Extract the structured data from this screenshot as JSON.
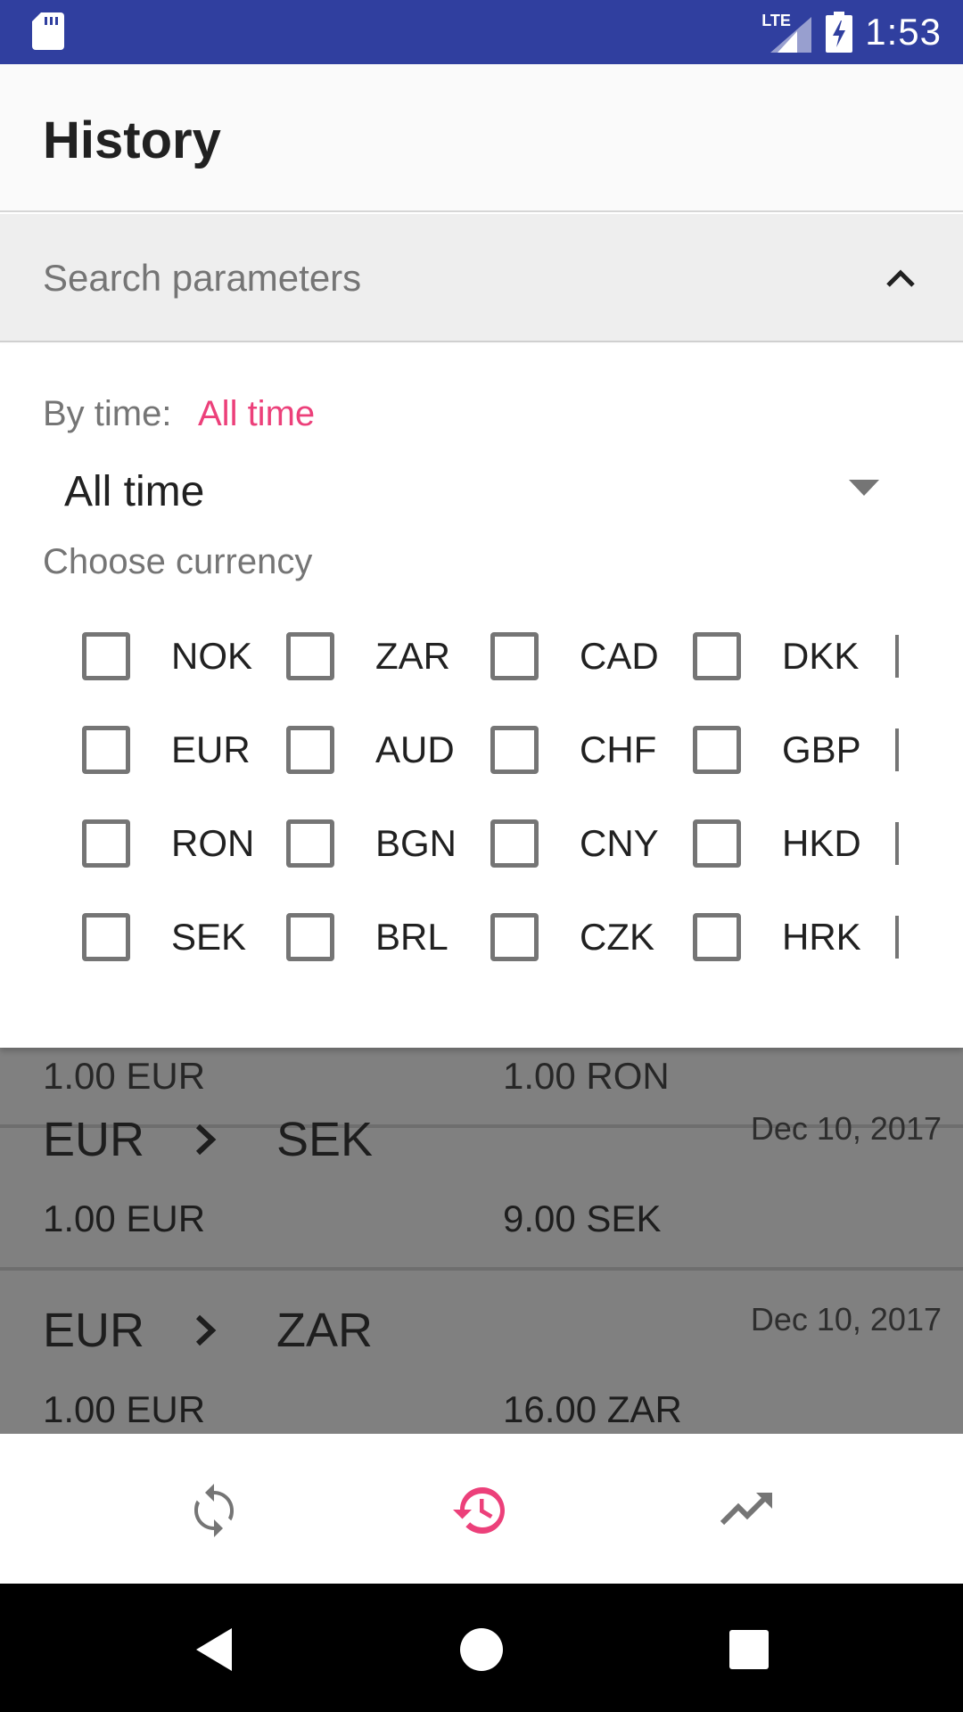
{
  "status_bar": {
    "time": "1:53",
    "network": "LTE",
    "icons": [
      "sd-card-icon",
      "signal-icon",
      "battery-charging-icon"
    ],
    "bg_color": "#303F9F"
  },
  "app_bar": {
    "title": "History"
  },
  "search_params": {
    "header_label": "Search parameters",
    "collapse_icon": "chevron-up-icon",
    "by_time_label": "By time:",
    "by_time_value": "All time",
    "time_select_value": "All time",
    "choose_currency_label": "Choose currency",
    "currencies": [
      [
        "NOK",
        "ZAR",
        "CAD",
        "DKK"
      ],
      [
        "EUR",
        "AUD",
        "CHF",
        "GBP"
      ],
      [
        "RON",
        "BGN",
        "CNY",
        "HKD"
      ],
      [
        "SEK",
        "BRL",
        "CZK",
        "HRK"
      ]
    ],
    "accent_color": "#EC407A"
  },
  "history": [
    {
      "from": "EUR",
      "to": "SEK",
      "date": "Dec 10, 2017",
      "amount_from": "1.00 EUR",
      "amount_to": "9.00 SEK"
    },
    {
      "from": "EUR",
      "to": "ZAR",
      "date": "Dec 10, 2017",
      "amount_from": "1.00 EUR",
      "amount_to": "16.00 ZAR"
    }
  ],
  "bottom_nav": {
    "items": [
      {
        "icon": "sync-icon",
        "active": false
      },
      {
        "icon": "history-icon",
        "active": true
      },
      {
        "icon": "trending-up-icon",
        "active": false
      }
    ]
  },
  "system_nav": {
    "icons": [
      "back-icon",
      "home-icon",
      "recents-icon"
    ]
  }
}
